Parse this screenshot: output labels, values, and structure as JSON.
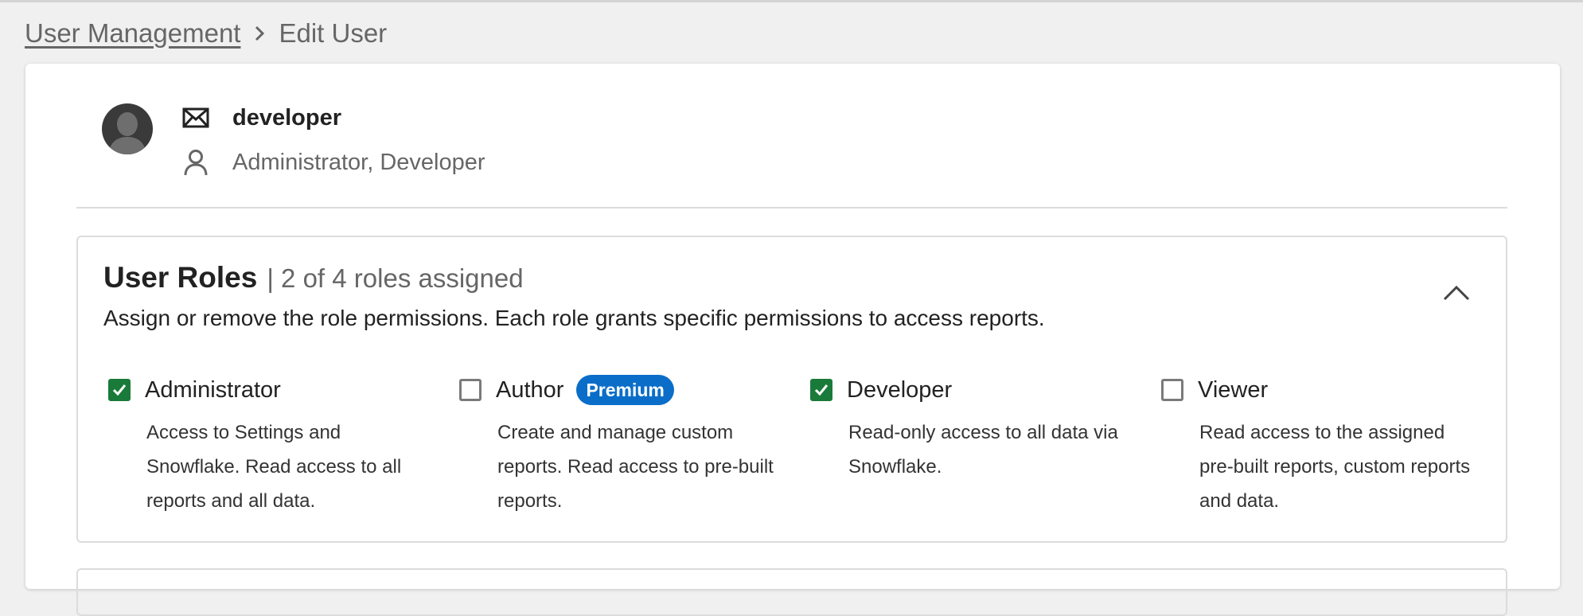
{
  "breadcrumb": {
    "parent": "User Management",
    "current": "Edit User"
  },
  "user": {
    "email": "developer",
    "roles_summary": "Administrator, Developer"
  },
  "roles_panel": {
    "title": "User Roles",
    "count_text": "| 2 of 4 roles assigned",
    "description": "Assign or remove the role permissions. Each role grants specific permissions to access reports."
  },
  "roles": [
    {
      "label": "Administrator",
      "checked": true,
      "badge": "",
      "description": "Access to Settings and Snowflake. Read access to all reports and all data."
    },
    {
      "label": "Author",
      "checked": false,
      "badge": "Premium",
      "description": "Create and manage custom reports. Read access to pre-built reports."
    },
    {
      "label": "Developer",
      "checked": true,
      "badge": "",
      "description": "Read-only access to all data via Snowflake."
    },
    {
      "label": "Viewer",
      "checked": false,
      "badge": "",
      "description": "Read access to the assigned pre-built reports, custom reports and data."
    }
  ],
  "icons": {
    "email": "envelope-icon",
    "role": "person-icon",
    "breadcrumb_separator": "chevron-right-icon",
    "collapse": "chevron-up-icon"
  },
  "colors": {
    "checked": "#1a7a3a",
    "badge": "#0a6ec9"
  }
}
